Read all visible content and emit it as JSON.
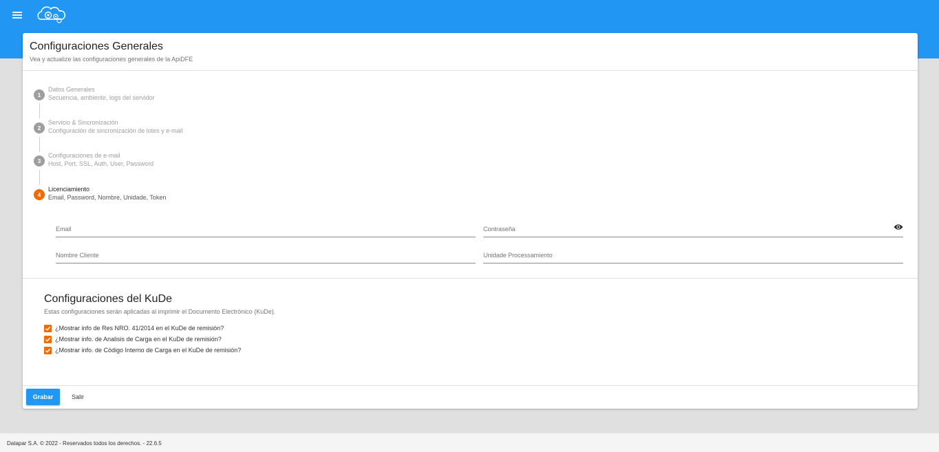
{
  "colors": {
    "primary": "#2196f3",
    "accent": "#ef6c00",
    "inactive_step": "#9e9e9e"
  },
  "topbar": {
    "menu_icon": "menu-icon",
    "logo_icon": "cloud-gears-logo"
  },
  "header": {
    "title": "Configuraciones Generales",
    "subtitle": "Vea y actualize las configuraciones generales de la ApiDFE"
  },
  "steps": [
    {
      "number": "1",
      "label": "Datos Generales",
      "sub": "Secuencia, ambiente, logs del servidor",
      "active": false
    },
    {
      "number": "2",
      "label": "Servicio & Sincronización",
      "sub": "Configuración de sincronización de lotes y e-mail",
      "active": false
    },
    {
      "number": "3",
      "label": "Configuraciones de e-mail",
      "sub": "Host, Port, SSL, Auth, User, Password",
      "active": false
    },
    {
      "number": "4",
      "label": "Licenciamiento",
      "sub": "Email, Password, Nombre, Unidade, Token",
      "active": true
    }
  ],
  "form": {
    "email_label": "Email",
    "password_label": "Contraseña",
    "client_label": "Nombre Cliente",
    "unit_label": "Unidade Processamiento"
  },
  "kude": {
    "title": "Configuraciones del KuDe",
    "subtitle": "Estas configuraciones serán aplicadas al imprimir el Documento Electrónico (KuDe).",
    "options": [
      {
        "label": "¿Mostrar info de Res NRO. 41/2014 en el KuDe de remisión?",
        "checked": true
      },
      {
        "label": "¿Mostrar info. de Analisis de Carga en el KuDe de remisión?",
        "checked": true
      },
      {
        "label": "¿Mostrar info. de Código Interno de Carga en el KuDe de remisión?",
        "checked": true
      }
    ]
  },
  "actions": {
    "save_label": "Grabar",
    "exit_label": "Salir"
  },
  "footer": {
    "text": "Datapar S.A. © 2022 - Reservados todos los derechos. - 22.6.5"
  }
}
